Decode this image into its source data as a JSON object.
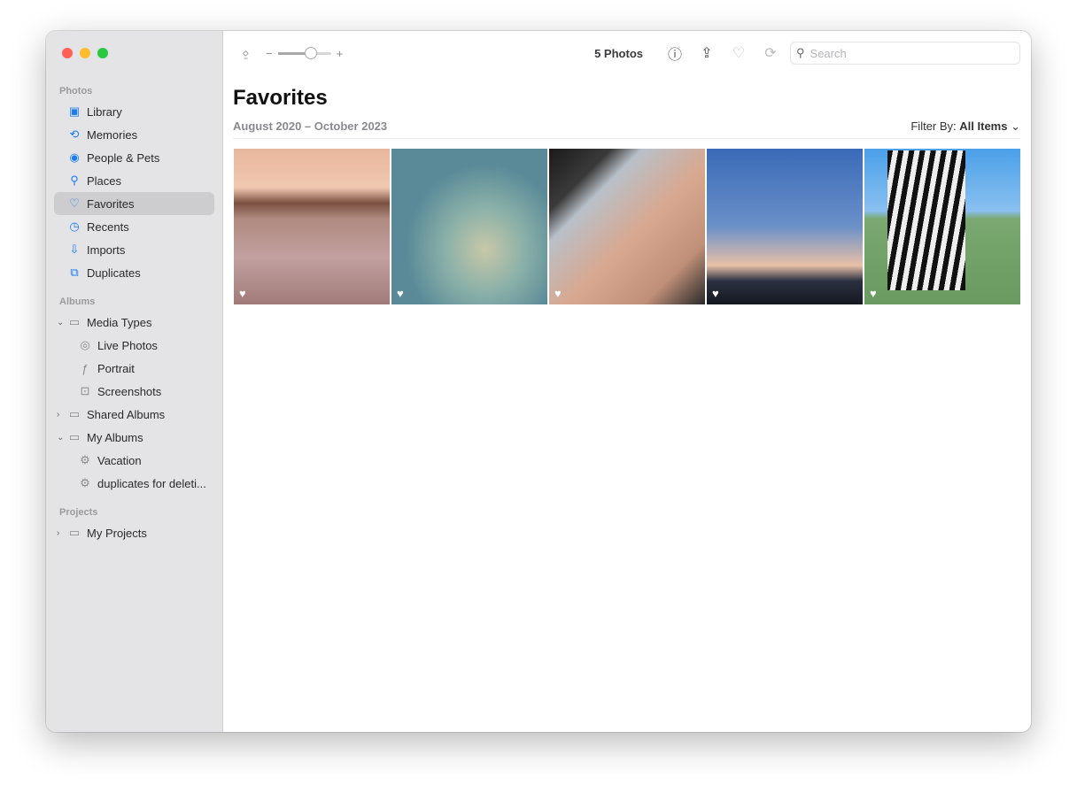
{
  "sidebar": {
    "sections": [
      {
        "label": "Photos"
      },
      {
        "label": "Albums"
      },
      {
        "label": "Projects"
      }
    ],
    "photos": [
      {
        "label": "Library",
        "icon": "library-icon"
      },
      {
        "label": "Memories",
        "icon": "memories-icon"
      },
      {
        "label": "People & Pets",
        "icon": "people-icon"
      },
      {
        "label": "Places",
        "icon": "places-icon"
      },
      {
        "label": "Favorites",
        "icon": "heart-icon"
      },
      {
        "label": "Recents",
        "icon": "clock-icon"
      },
      {
        "label": "Imports",
        "icon": "import-icon"
      },
      {
        "label": "Duplicates",
        "icon": "duplicates-icon"
      }
    ],
    "albums": [
      {
        "label": "Media Types"
      },
      {
        "label": "Live Photos"
      },
      {
        "label": "Portrait"
      },
      {
        "label": "Screenshots"
      },
      {
        "label": "Shared Albums"
      },
      {
        "label": "My Albums"
      },
      {
        "label": "Vacation"
      },
      {
        "label": "duplicates for deleti..."
      }
    ],
    "projects": [
      {
        "label": "My Projects"
      }
    ]
  },
  "toolbar": {
    "minus": "−",
    "plus": "+",
    "zoom_level": 0.62,
    "count": "5 Photos",
    "search_placeholder": "Search"
  },
  "main": {
    "title": "Favorites",
    "date_range": "August 2020 – October 2023",
    "filter_label": "Filter By:",
    "filter_value": "All Items"
  },
  "photos": [
    {
      "favorite": true
    },
    {
      "favorite": true
    },
    {
      "favorite": true
    },
    {
      "favorite": true
    },
    {
      "favorite": true
    }
  ]
}
